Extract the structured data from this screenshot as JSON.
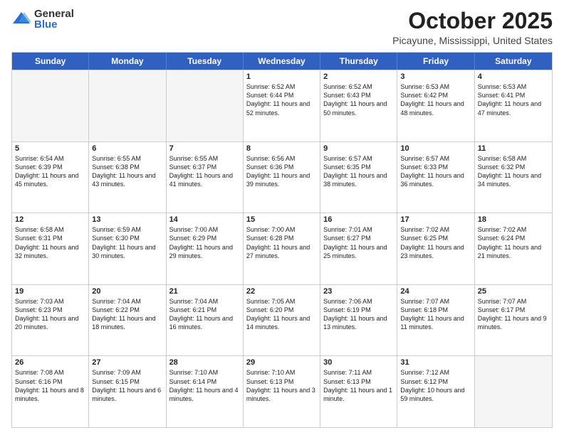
{
  "logo": {
    "general": "General",
    "blue": "Blue"
  },
  "header": {
    "month": "October 2025",
    "location": "Picayune, Mississippi, United States"
  },
  "weekdays": [
    "Sunday",
    "Monday",
    "Tuesday",
    "Wednesday",
    "Thursday",
    "Friday",
    "Saturday"
  ],
  "rows": [
    [
      {
        "day": "",
        "sunrise": "",
        "sunset": "",
        "daylight": ""
      },
      {
        "day": "",
        "sunrise": "",
        "sunset": "",
        "daylight": ""
      },
      {
        "day": "",
        "sunrise": "",
        "sunset": "",
        "daylight": ""
      },
      {
        "day": "1",
        "sunrise": "Sunrise: 6:52 AM",
        "sunset": "Sunset: 6:44 PM",
        "daylight": "Daylight: 11 hours and 52 minutes."
      },
      {
        "day": "2",
        "sunrise": "Sunrise: 6:52 AM",
        "sunset": "Sunset: 6:43 PM",
        "daylight": "Daylight: 11 hours and 50 minutes."
      },
      {
        "day": "3",
        "sunrise": "Sunrise: 6:53 AM",
        "sunset": "Sunset: 6:42 PM",
        "daylight": "Daylight: 11 hours and 48 minutes."
      },
      {
        "day": "4",
        "sunrise": "Sunrise: 6:53 AM",
        "sunset": "Sunset: 6:41 PM",
        "daylight": "Daylight: 11 hours and 47 minutes."
      }
    ],
    [
      {
        "day": "5",
        "sunrise": "Sunrise: 6:54 AM",
        "sunset": "Sunset: 6:39 PM",
        "daylight": "Daylight: 11 hours and 45 minutes."
      },
      {
        "day": "6",
        "sunrise": "Sunrise: 6:55 AM",
        "sunset": "Sunset: 6:38 PM",
        "daylight": "Daylight: 11 hours and 43 minutes."
      },
      {
        "day": "7",
        "sunrise": "Sunrise: 6:55 AM",
        "sunset": "Sunset: 6:37 PM",
        "daylight": "Daylight: 11 hours and 41 minutes."
      },
      {
        "day": "8",
        "sunrise": "Sunrise: 6:56 AM",
        "sunset": "Sunset: 6:36 PM",
        "daylight": "Daylight: 11 hours and 39 minutes."
      },
      {
        "day": "9",
        "sunrise": "Sunrise: 6:57 AM",
        "sunset": "Sunset: 6:35 PM",
        "daylight": "Daylight: 11 hours and 38 minutes."
      },
      {
        "day": "10",
        "sunrise": "Sunrise: 6:57 AM",
        "sunset": "Sunset: 6:33 PM",
        "daylight": "Daylight: 11 hours and 36 minutes."
      },
      {
        "day": "11",
        "sunrise": "Sunrise: 6:58 AM",
        "sunset": "Sunset: 6:32 PM",
        "daylight": "Daylight: 11 hours and 34 minutes."
      }
    ],
    [
      {
        "day": "12",
        "sunrise": "Sunrise: 6:58 AM",
        "sunset": "Sunset: 6:31 PM",
        "daylight": "Daylight: 11 hours and 32 minutes."
      },
      {
        "day": "13",
        "sunrise": "Sunrise: 6:59 AM",
        "sunset": "Sunset: 6:30 PM",
        "daylight": "Daylight: 11 hours and 30 minutes."
      },
      {
        "day": "14",
        "sunrise": "Sunrise: 7:00 AM",
        "sunset": "Sunset: 6:29 PM",
        "daylight": "Daylight: 11 hours and 29 minutes."
      },
      {
        "day": "15",
        "sunrise": "Sunrise: 7:00 AM",
        "sunset": "Sunset: 6:28 PM",
        "daylight": "Daylight: 11 hours and 27 minutes."
      },
      {
        "day": "16",
        "sunrise": "Sunrise: 7:01 AM",
        "sunset": "Sunset: 6:27 PM",
        "daylight": "Daylight: 11 hours and 25 minutes."
      },
      {
        "day": "17",
        "sunrise": "Sunrise: 7:02 AM",
        "sunset": "Sunset: 6:25 PM",
        "daylight": "Daylight: 11 hours and 23 minutes."
      },
      {
        "day": "18",
        "sunrise": "Sunrise: 7:02 AM",
        "sunset": "Sunset: 6:24 PM",
        "daylight": "Daylight: 11 hours and 21 minutes."
      }
    ],
    [
      {
        "day": "19",
        "sunrise": "Sunrise: 7:03 AM",
        "sunset": "Sunset: 6:23 PM",
        "daylight": "Daylight: 11 hours and 20 minutes."
      },
      {
        "day": "20",
        "sunrise": "Sunrise: 7:04 AM",
        "sunset": "Sunset: 6:22 PM",
        "daylight": "Daylight: 11 hours and 18 minutes."
      },
      {
        "day": "21",
        "sunrise": "Sunrise: 7:04 AM",
        "sunset": "Sunset: 6:21 PM",
        "daylight": "Daylight: 11 hours and 16 minutes."
      },
      {
        "day": "22",
        "sunrise": "Sunrise: 7:05 AM",
        "sunset": "Sunset: 6:20 PM",
        "daylight": "Daylight: 11 hours and 14 minutes."
      },
      {
        "day": "23",
        "sunrise": "Sunrise: 7:06 AM",
        "sunset": "Sunset: 6:19 PM",
        "daylight": "Daylight: 11 hours and 13 minutes."
      },
      {
        "day": "24",
        "sunrise": "Sunrise: 7:07 AM",
        "sunset": "Sunset: 6:18 PM",
        "daylight": "Daylight: 11 hours and 11 minutes."
      },
      {
        "day": "25",
        "sunrise": "Sunrise: 7:07 AM",
        "sunset": "Sunset: 6:17 PM",
        "daylight": "Daylight: 11 hours and 9 minutes."
      }
    ],
    [
      {
        "day": "26",
        "sunrise": "Sunrise: 7:08 AM",
        "sunset": "Sunset: 6:16 PM",
        "daylight": "Daylight: 11 hours and 8 minutes."
      },
      {
        "day": "27",
        "sunrise": "Sunrise: 7:09 AM",
        "sunset": "Sunset: 6:15 PM",
        "daylight": "Daylight: 11 hours and 6 minutes."
      },
      {
        "day": "28",
        "sunrise": "Sunrise: 7:10 AM",
        "sunset": "Sunset: 6:14 PM",
        "daylight": "Daylight: 11 hours and 4 minutes."
      },
      {
        "day": "29",
        "sunrise": "Sunrise: 7:10 AM",
        "sunset": "Sunset: 6:13 PM",
        "daylight": "Daylight: 11 hours and 3 minutes."
      },
      {
        "day": "30",
        "sunrise": "Sunrise: 7:11 AM",
        "sunset": "Sunset: 6:13 PM",
        "daylight": "Daylight: 11 hours and 1 minute."
      },
      {
        "day": "31",
        "sunrise": "Sunrise: 7:12 AM",
        "sunset": "Sunset: 6:12 PM",
        "daylight": "Daylight: 10 hours and 59 minutes."
      },
      {
        "day": "",
        "sunrise": "",
        "sunset": "",
        "daylight": ""
      }
    ]
  ]
}
